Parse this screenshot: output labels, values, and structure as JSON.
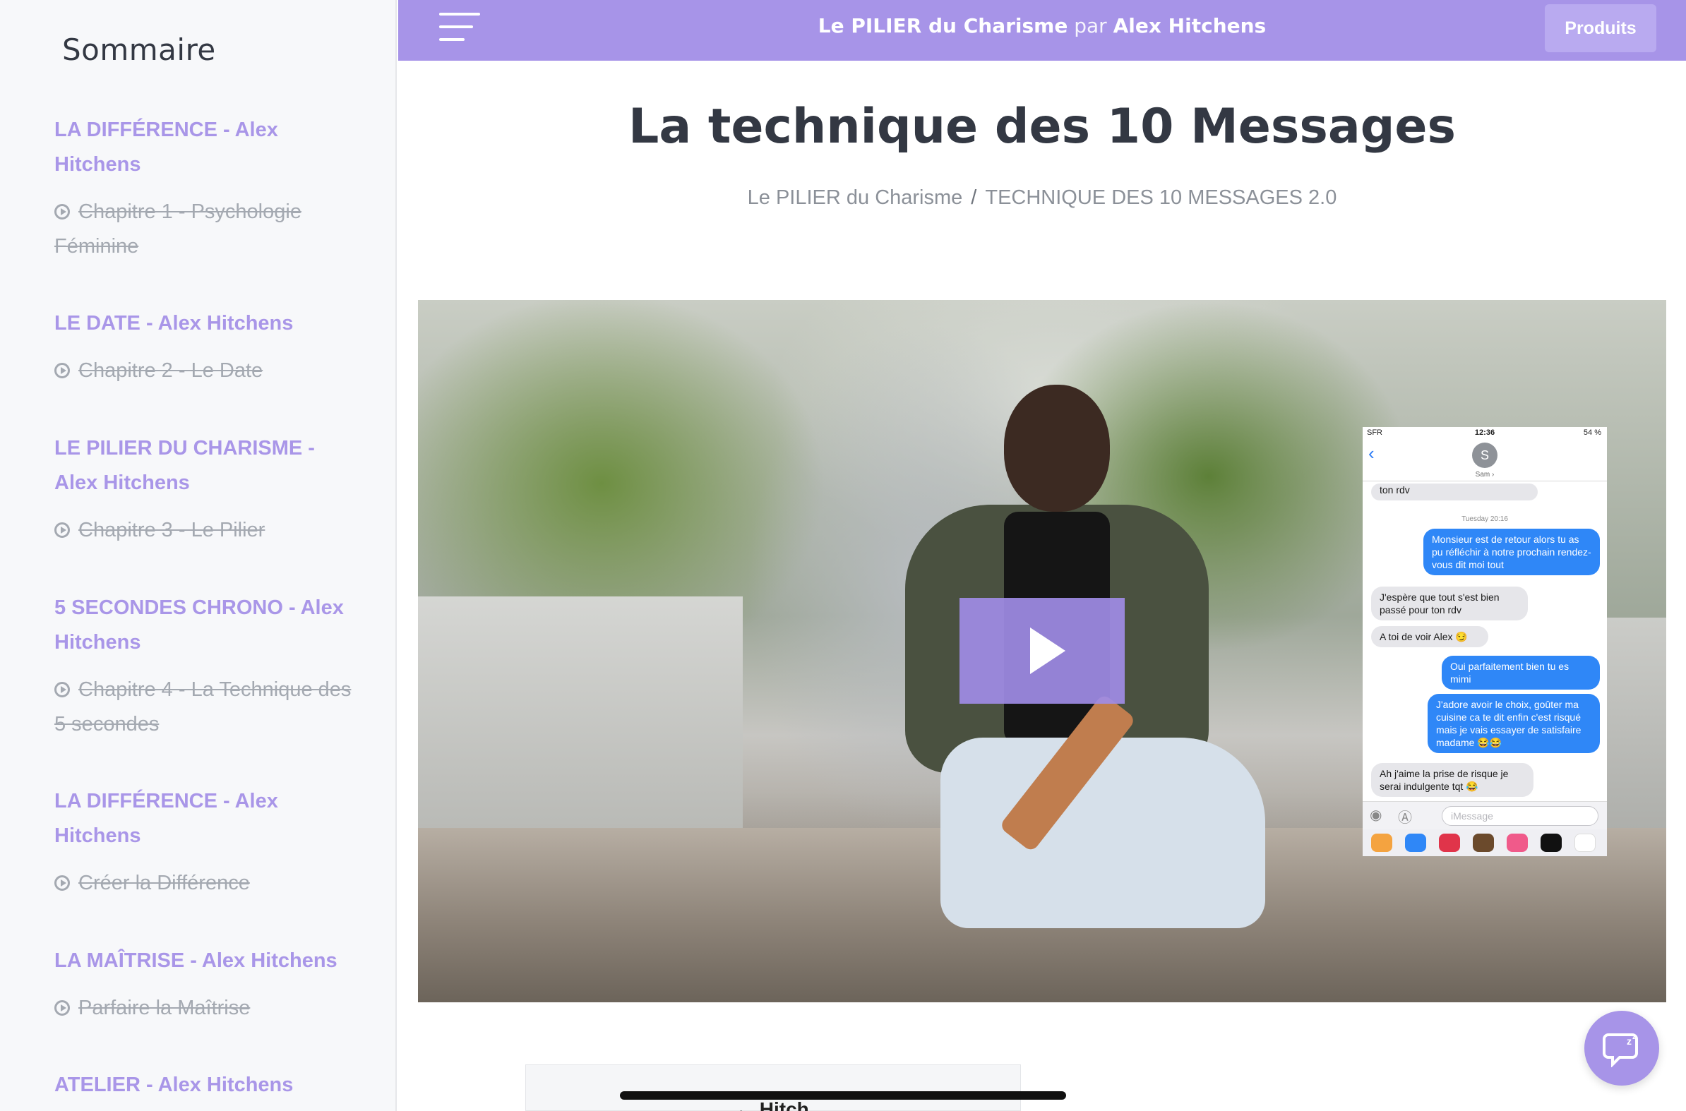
{
  "sidebar": {
    "title": "Sommaire",
    "sections": [
      {
        "title": "LA DIFFÉRENCE - Alex Hitchens",
        "chapter": "Chapitre 1 - Psychologie Féminine"
      },
      {
        "title": "LE DATE - Alex Hitchens",
        "chapter": "Chapitre 2 - Le Date"
      },
      {
        "title": "LE PILIER DU CHARISME - Alex Hitchens",
        "chapter": "Chapitre 3 - Le Pilier"
      },
      {
        "title": "5 SECONDES CHRONO - Alex Hitchens",
        "chapter": "Chapitre 4 - La Technique des 5 secondes"
      },
      {
        "title": "LA DIFFÉRENCE - Alex Hitchens",
        "chapter": "Créer la Différence"
      },
      {
        "title": "LA MAÎTRISE - Alex Hitchens",
        "chapter": "Parfaire la Maîtrise"
      },
      {
        "title": "ATELIER - Alex Hitchens",
        "chapter": ""
      }
    ]
  },
  "topbar": {
    "brand_main": "Le PILIER du Charisme",
    "brand_par": "par",
    "brand_author": "Alex Hitchens",
    "produits_label": "Produits"
  },
  "main": {
    "title": "La technique des 10 Messages",
    "breadcrumb": [
      "Le PILIER du Charisme",
      "TECHNIQUE DES 10 MESSAGES 2.0"
    ],
    "breadcrumb_sep": "/",
    "below_link": "← Hitch"
  },
  "phone": {
    "carrier": "SFR",
    "time": "12:36",
    "battery": "54 %",
    "avatar_initial": "S",
    "contact": "Sam ›",
    "timestamp": "Tuesday 20:16",
    "input_placeholder": "iMessage",
    "messages": [
      {
        "dir": "in",
        "text": "ton rdv"
      },
      {
        "dir": "out",
        "text": "Monsieur est de retour alors tu as pu réfléchir à notre prochain rendez-vous dit moi tout"
      },
      {
        "dir": "in",
        "text": "J'espère que tout s'est bien passé pour ton rdv"
      },
      {
        "dir": "in",
        "text": "A toi de voir Alex 😏"
      },
      {
        "dir": "out",
        "text": "Oui parfaitement bien tu es mimi"
      },
      {
        "dir": "out",
        "text": "J'adore avoir le choix, goûter ma cuisine ca te dit enfin c'est risqué mais je vais essayer de satisfaire madame 😂😂"
      },
      {
        "dir": "in",
        "text": "Ah j'aime la prise de risque je serai indulgente tqt 😂"
      }
    ]
  },
  "colors": {
    "accent": "#a794e8",
    "sidebar_bg": "#f7f8fa",
    "bubble_out": "#2f87f7",
    "bubble_in": "#e6e6ea"
  },
  "icons": {
    "menu": "hamburger-menu-icon",
    "play": "play-icon",
    "chapter": "play-circle-icon",
    "chat": "chat-bubble-icon"
  }
}
